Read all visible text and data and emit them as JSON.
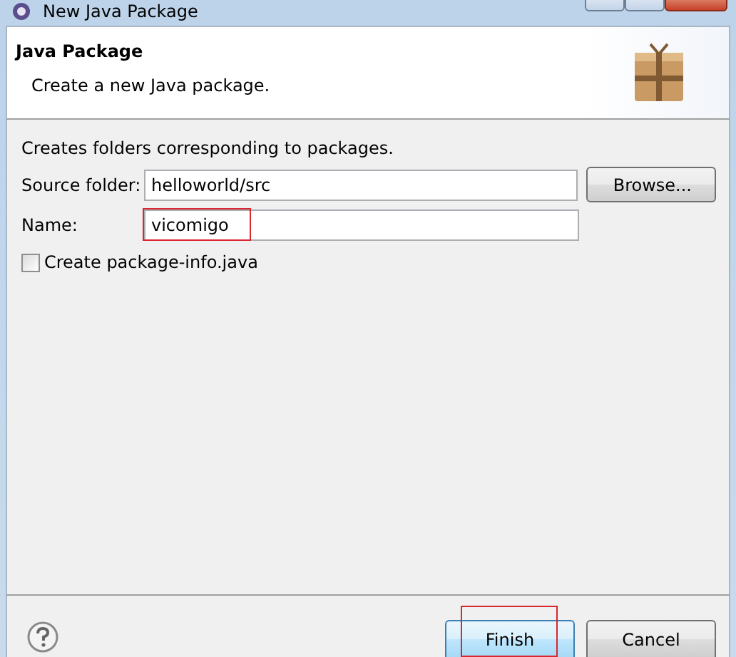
{
  "window": {
    "title": "New Java Package"
  },
  "header": {
    "title": "Java Package",
    "description": "Create a new Java package."
  },
  "intro": "Creates folders corresponding to packages.",
  "fields": [
    {
      "label": "Source folder:",
      "value": "helloworld/src",
      "highlighted": false,
      "button": "Browse..."
    },
    {
      "label": "Name:",
      "value": "vicomigo",
      "highlighted": true
    }
  ],
  "checkbox": {
    "label": "Create package-info.java",
    "checked": false
  },
  "buttons": [
    {
      "label": "Finish",
      "default": true,
      "highlighted": true
    },
    {
      "label": "Cancel",
      "default": false,
      "highlighted": false
    }
  ]
}
